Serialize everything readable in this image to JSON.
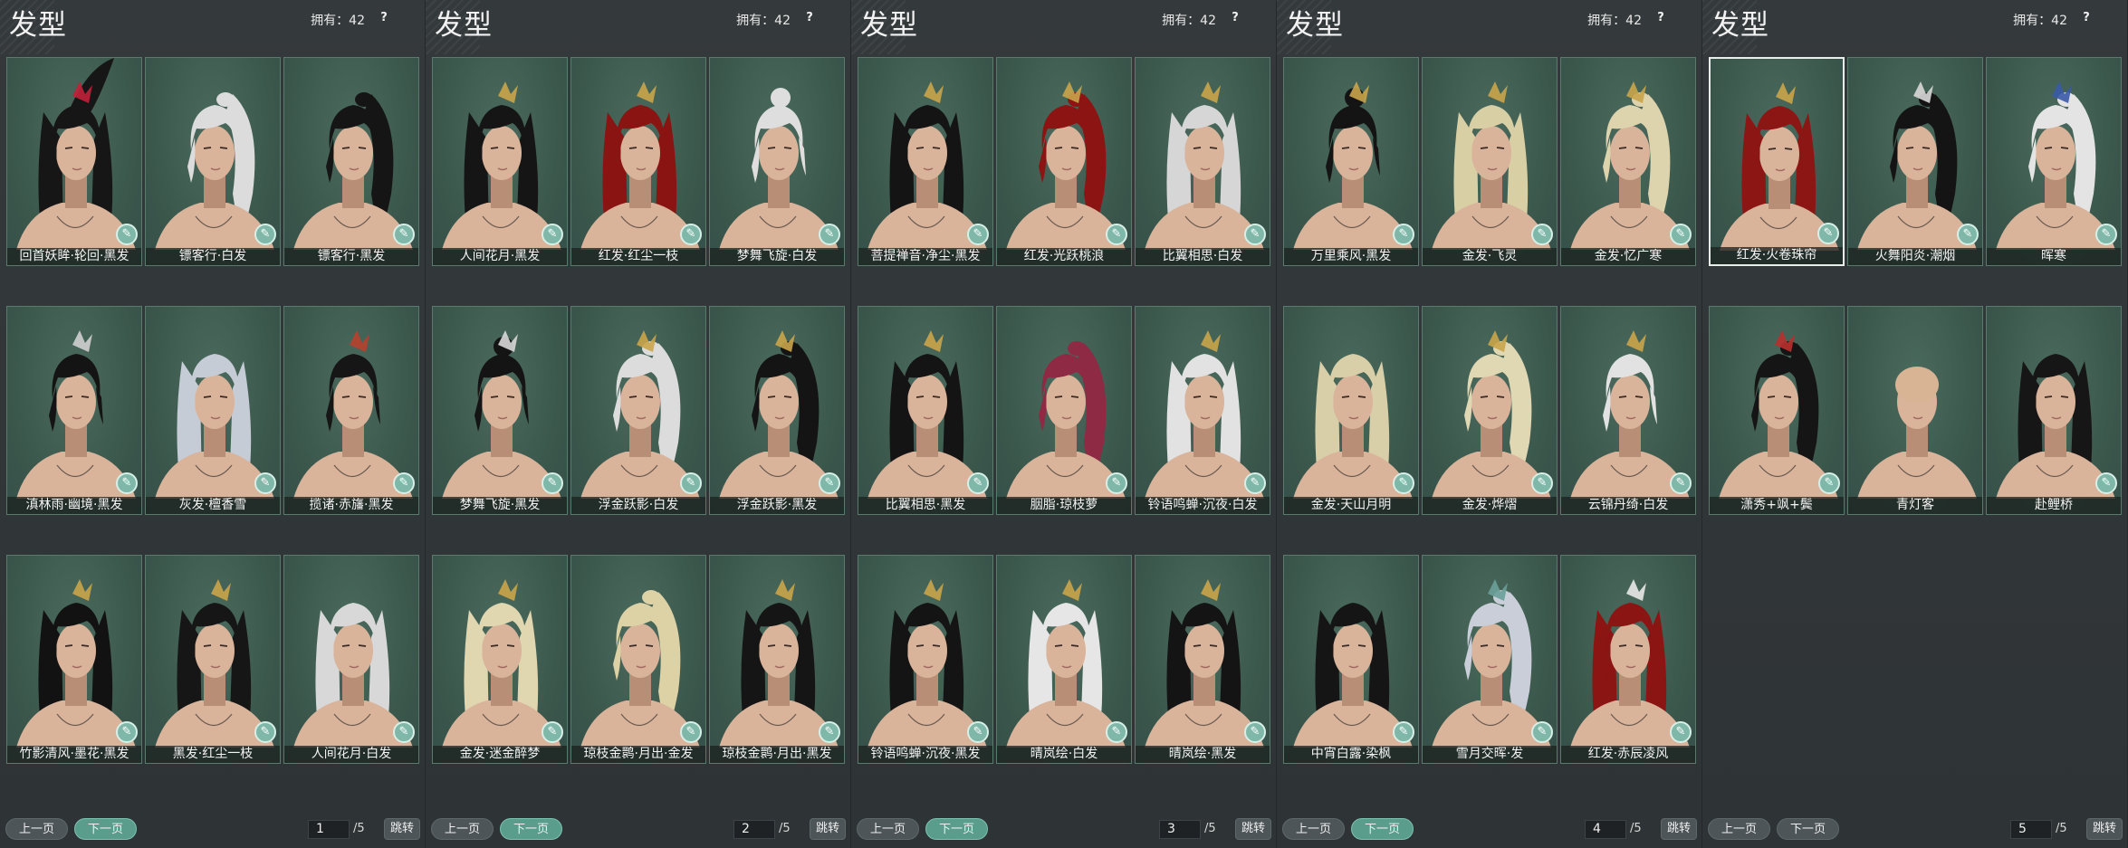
{
  "title": "发型",
  "owned": "拥有：42",
  "help": "?",
  "prev": "上一页",
  "next": "下一页",
  "total": "/5",
  "jump": "跳转",
  "pages": [
    {
      "page": "1",
      "items": [
        {
          "name": "回首妖眸·轮回·黑发",
          "hair": "#161616",
          "style": "tall",
          "ornament": "#c0213a"
        },
        {
          "name": "镖客行·白发",
          "hair": "#dcdcdc",
          "style": "pony"
        },
        {
          "name": "镖客行·黑发",
          "hair": "#151515",
          "style": "pony"
        },
        {
          "name": "滇林雨·幽境·黑发",
          "hair": "#141414",
          "style": "short",
          "ornament": "#cfcfcf"
        },
        {
          "name": "灰发·檀香雪",
          "hair": "#c6ccd6",
          "style": "long"
        },
        {
          "name": "揽诸·赤旛·黑发",
          "hair": "#161616",
          "style": "short",
          "ornament": "#b8402d"
        },
        {
          "name": "竹影清风·墨花·黑发",
          "hair": "#121212",
          "style": "long",
          "ornament": "#c9a44a"
        },
        {
          "name": "黑发·红尘一枝",
          "hair": "#161616",
          "style": "long",
          "ornament": "#c9a44a"
        },
        {
          "name": "人间花月·白发",
          "hair": "#d8d8d8",
          "style": "long"
        }
      ]
    },
    {
      "page": "2",
      "items": [
        {
          "name": "人间花月·黑发",
          "hair": "#151515",
          "style": "long",
          "ornament": "#c9a44a"
        },
        {
          "name": "红发·红尘一枝",
          "hair": "#8a1412",
          "style": "long",
          "ornament": "#c9a44a"
        },
        {
          "name": "梦舞飞旋·白发",
          "hair": "#dedede",
          "style": "bun"
        },
        {
          "name": "梦舞飞旋·黑发",
          "hair": "#141414",
          "style": "bun",
          "ornament": "#d8d8d8"
        },
        {
          "name": "浮金跃影·白发",
          "hair": "#dcdcdc",
          "style": "pony",
          "ornament": "#c9a44a"
        },
        {
          "name": "浮金跃影·黑发",
          "hair": "#141414",
          "style": "pony",
          "ornament": "#c9a44a"
        },
        {
          "name": "金发·迷金醉梦",
          "hair": "#e0d6b0",
          "style": "long",
          "ornament": "#c9a44a"
        },
        {
          "name": "琼枝金鹮·月出·金发",
          "hair": "#ddd1a6",
          "style": "pony"
        },
        {
          "name": "琼枝金鹮·月出·黑发",
          "hair": "#151515",
          "style": "long",
          "ornament": "#c9a44a"
        }
      ]
    },
    {
      "page": "3",
      "items": [
        {
          "name": "菩提禅音·净尘·黑发",
          "hair": "#141414",
          "style": "long",
          "ornament": "#c9a44a"
        },
        {
          "name": "红发·光跃桃浪",
          "hair": "#8c1514",
          "style": "pony",
          "ornament": "#c9a44a"
        },
        {
          "name": "比翼相思·白发",
          "hair": "#d6d6d6",
          "style": "long",
          "ornament": "#c9a44a"
        },
        {
          "name": "比翼相思·黑发",
          "hair": "#141414",
          "style": "long",
          "ornament": "#c9a44a"
        },
        {
          "name": "胭脂·琼枝萝",
          "hair": "#8e2a44",
          "style": "pony"
        },
        {
          "name": "铃语鸣蝉·沉夜·白发",
          "hair": "#e2e2e2",
          "style": "long",
          "ornament": "#c9a44a"
        },
        {
          "name": "铃语鸣蝉·沉夜·黑发",
          "hair": "#141414",
          "style": "long",
          "ornament": "#c9a44a"
        },
        {
          "name": "晴岚绘·白发",
          "hair": "#e6e6e6",
          "style": "long",
          "ornament": "#c9a44a"
        },
        {
          "name": "晴岚绘·黑发",
          "hair": "#141414",
          "style": "long",
          "ornament": "#c9a44a"
        }
      ]
    },
    {
      "page": "4",
      "items": [
        {
          "name": "万里乘风·黑发",
          "hair": "#141414",
          "style": "bun",
          "ornament": "#c9a44a"
        },
        {
          "name": "金发·飞灵",
          "hair": "#d9cfa5",
          "style": "long",
          "ornament": "#c9a44a"
        },
        {
          "name": "金发·忆广寒",
          "hair": "#ddd4ad",
          "style": "pony",
          "ornament": "#c9a44a"
        },
        {
          "name": "金发·天山月明",
          "hair": "#d8cfa8",
          "style": "long"
        },
        {
          "name": "金发·烨熠",
          "hair": "#e0d7b3",
          "style": "pony",
          "ornament": "#c9a44a"
        },
        {
          "name": "云锦丹绮·白发",
          "hair": "#e2e2e2",
          "style": "short",
          "ornament": "#c9a44a"
        },
        {
          "name": "中宵白露·染枫",
          "hair": "#151515",
          "style": "long"
        },
        {
          "name": "雪月交晖·发",
          "hair": "#c9ced8",
          "style": "pony",
          "ornament": "#6aa09a"
        },
        {
          "name": "红发·赤辰凌风",
          "hair": "#8b1512",
          "style": "long",
          "ornament": "#e8e8e8"
        }
      ]
    },
    {
      "page": "5",
      "items": [
        {
          "name": "红发·火卷珠帘",
          "hair": "#8c1614",
          "style": "long",
          "ornament": "#c9a44a",
          "selected": true
        },
        {
          "name": "火舞阳炎·潮烟",
          "hair": "#141414",
          "style": "pony",
          "ornament": "#d8d8d8"
        },
        {
          "name": "晖寒",
          "hair": "#e4e4e4",
          "style": "pony",
          "ornament": "#3a5aa8"
        },
        {
          "name": "潇秀+飒+鬓",
          "hair": "#151515",
          "style": "pony",
          "ornament": "#b8302d"
        },
        {
          "name": "青灯客",
          "hair": "#d9b494",
          "style": "bald"
        },
        {
          "name": "赴鲤桥",
          "hair": "#161616",
          "style": "long"
        }
      ]
    }
  ]
}
